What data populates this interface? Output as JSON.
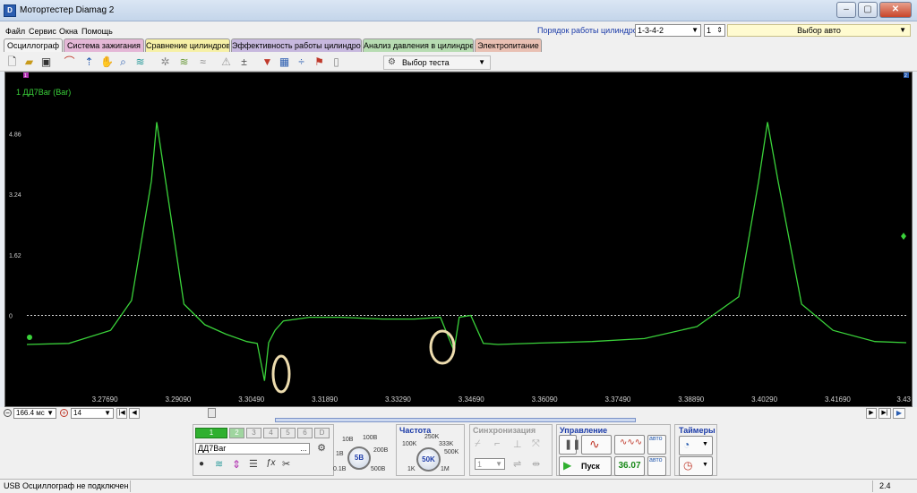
{
  "window": {
    "title": "Мотортестер Diamag 2"
  },
  "menu": {
    "items": [
      "Файл",
      "Сервис",
      "Окна",
      "Помощь"
    ]
  },
  "cylinders": {
    "order_label": "Порядок работы цилиндров",
    "order_value": "1-3-4-2",
    "cylinder_value": "1"
  },
  "car_select": {
    "label": "Выбор авто"
  },
  "tabs": [
    {
      "label": "Осциллограф",
      "color": "#f4f4f4",
      "active": true
    },
    {
      "label": "Система зажигания",
      "color": "#e4b7d6"
    },
    {
      "label": "Сравнение цилиндров",
      "color": "#f6f0a6"
    },
    {
      "label": "Эффективность работы цилиндров",
      "color": "#c7b8de"
    },
    {
      "label": "Анализ давления в цилиндре",
      "color": "#b7dcb2"
    },
    {
      "label": "Электропитание",
      "color": "#e9c0b3"
    }
  ],
  "toolbar": {
    "test_select_label": "Выбор теста"
  },
  "scope": {
    "channel_label": "1 ДД7Bar (Bar)",
    "trace_color": "#3ad23a",
    "y_ticks": [
      "4.86",
      "3.24",
      "1.62",
      "0"
    ],
    "x_ticks": [
      "3.27690",
      "3.29090",
      "3.30490",
      "3.31890",
      "3.33290",
      "3.34690",
      "3.36090",
      "3.37490",
      "3.38890",
      "3.40290",
      "3.41690",
      "3.43"
    ],
    "marker_left": "1",
    "marker_right": "2"
  },
  "chart_data": {
    "type": "line",
    "series": [
      {
        "name": "ДД7Bar",
        "x": [
          3.262,
          3.27,
          3.278,
          3.282,
          3.2858,
          3.2868,
          3.2885,
          3.292,
          3.296,
          3.3,
          3.304,
          3.306,
          3.3074,
          3.3082,
          3.3094,
          3.311,
          3.316,
          3.322,
          3.33,
          3.336,
          3.341,
          3.3436,
          3.3446,
          3.3468,
          3.3492,
          3.352,
          3.36,
          3.37,
          3.38,
          3.39,
          3.398,
          3.4018,
          3.4035,
          3.4055,
          3.41,
          3.416,
          3.424,
          3.43
        ],
        "y": [
          -0.78,
          -0.75,
          -0.4,
          0.4,
          3.6,
          5.17,
          3.6,
          0.3,
          -0.25,
          -0.5,
          -0.7,
          -0.75,
          -1.75,
          -0.73,
          -0.4,
          -0.15,
          -0.05,
          -0.05,
          -0.1,
          -0.1,
          -0.05,
          -0.95,
          -0.05,
          0.0,
          -0.75,
          -0.78,
          -0.74,
          -0.7,
          -0.62,
          -0.3,
          0.5,
          3.6,
          5.17,
          3.6,
          0.3,
          -0.4,
          -0.7,
          -0.73
        ]
      }
    ],
    "xlabel": "",
    "ylabel": "",
    "xlim": [
      3.262,
      3.43
    ],
    "ylim": [
      -2.0,
      6.5
    ],
    "grid": false,
    "zero_line": true
  },
  "controls": {
    "timebase_value": "166.4 мс",
    "count_value": "14",
    "channels": [
      "1",
      "2",
      "3",
      "4",
      "5",
      "6",
      "D"
    ],
    "sensor_name": "ДД7Bar",
    "voltage_knob": {
      "value": "5В",
      "ticks": [
        "10В",
        "100В",
        "200В",
        "500В",
        "1В",
        "0.1В"
      ]
    },
    "frequency": {
      "title": "Частота",
      "value": "50K",
      "ticks": [
        "250K",
        "333K",
        "500K",
        "1M",
        "1K",
        "100K"
      ]
    },
    "sync": {
      "title": "Синхронизация",
      "value": "1"
    },
    "control": {
      "title": "Управление",
      "start_label": "Пуск",
      "fps_value": "36.07",
      "auto_label": "авто"
    },
    "timers": {
      "title": "Таймеры"
    }
  },
  "status": {
    "usb_text": "USB Осциллограф не подключен",
    "version": "2.4"
  }
}
